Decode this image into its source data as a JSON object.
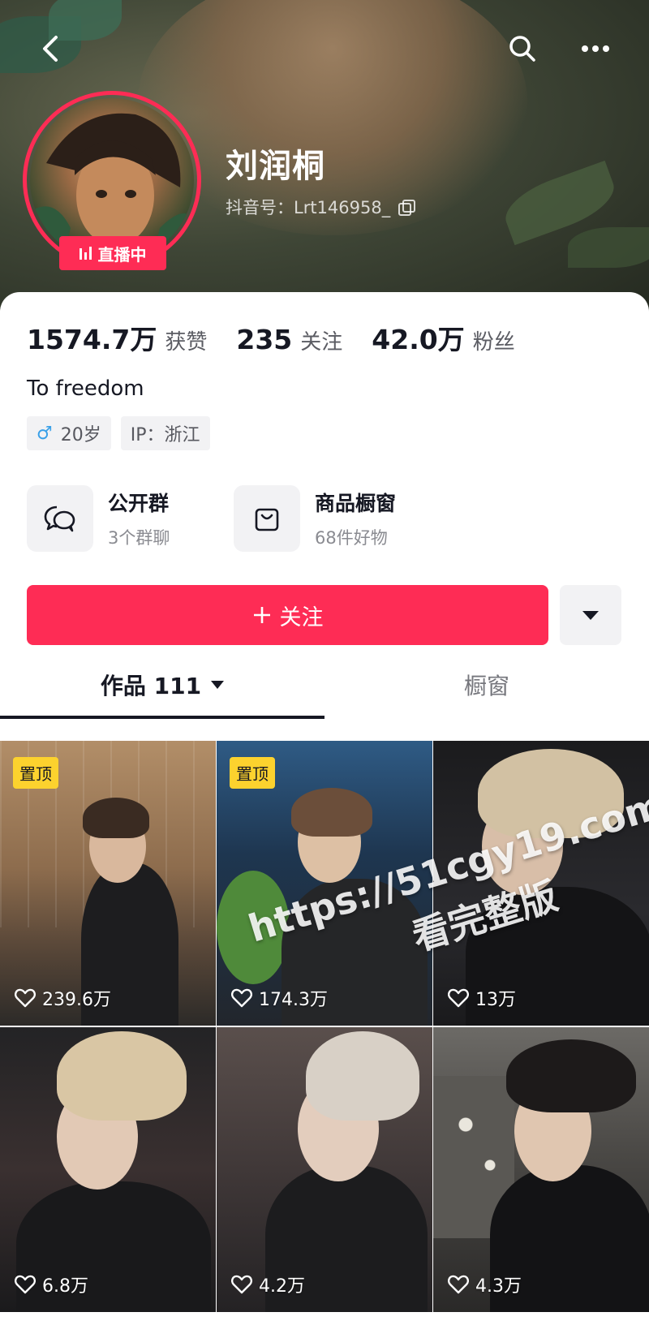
{
  "profile": {
    "nickname": "刘润桐",
    "douyin_id": "抖音号：Lrt146958_",
    "live_label": "直播中",
    "bio": "To freedom"
  },
  "stats": [
    {
      "value": "1574.7万",
      "label": "获赞"
    },
    {
      "value": "235",
      "label": "关注"
    },
    {
      "value": "42.0万",
      "label": "粉丝"
    }
  ],
  "tags": {
    "age": "20岁",
    "ip": "IP：浙江"
  },
  "entries": [
    {
      "title": "公开群",
      "subtitle": "3个群聊",
      "icon": "chat-bubbles-icon"
    },
    {
      "title": "商品橱窗",
      "subtitle": "68件好物",
      "icon": "shopping-bag-icon"
    }
  ],
  "actions": {
    "follow_label": "关注"
  },
  "tabs": [
    {
      "label": "作品 111"
    },
    {
      "label": "橱窗"
    }
  ],
  "videos": [
    {
      "likes": "239.6万",
      "pinned": "置顶"
    },
    {
      "likes": "174.3万",
      "pinned": "置顶"
    },
    {
      "likes": "13万"
    },
    {
      "likes": "6.8万"
    },
    {
      "likes": "4.2万"
    },
    {
      "likes": "4.3万"
    }
  ],
  "watermark": {
    "line1": "https://51cgy19.com",
    "line2": "看完整版"
  },
  "colors": {
    "accent": "#fe2c55",
    "pin_badge": "#fcd22e",
    "text_primary": "#161823"
  }
}
